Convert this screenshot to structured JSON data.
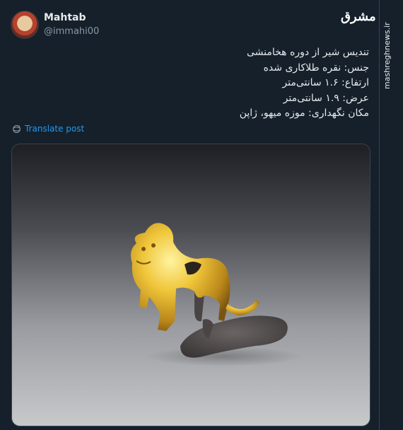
{
  "author": {
    "name": "Mahtab",
    "handle": "@immahi00"
  },
  "brand": {
    "logo_text": "مشرق",
    "watermark": "mashreghnews.ir"
  },
  "post": {
    "lines": [
      "تندیس شیر از دوره هخامنشی",
      "جنس: نقره طلاکاری شده",
      "ارتفاع: ۱.۶ سانتی‌متر",
      "عرض: ۱.۹ سانتی‌متر",
      "مکان نگهداری: موزه میهو، ژاپن"
    ],
    "translate_label": "Translate post"
  },
  "colors": {
    "background": "#15202b",
    "link": "#1d9bf0",
    "text": "#e7e9ea",
    "muted": "#8b98a5"
  },
  "icons": {
    "translate": "globe-icon",
    "logo": "mashregh-logo"
  }
}
